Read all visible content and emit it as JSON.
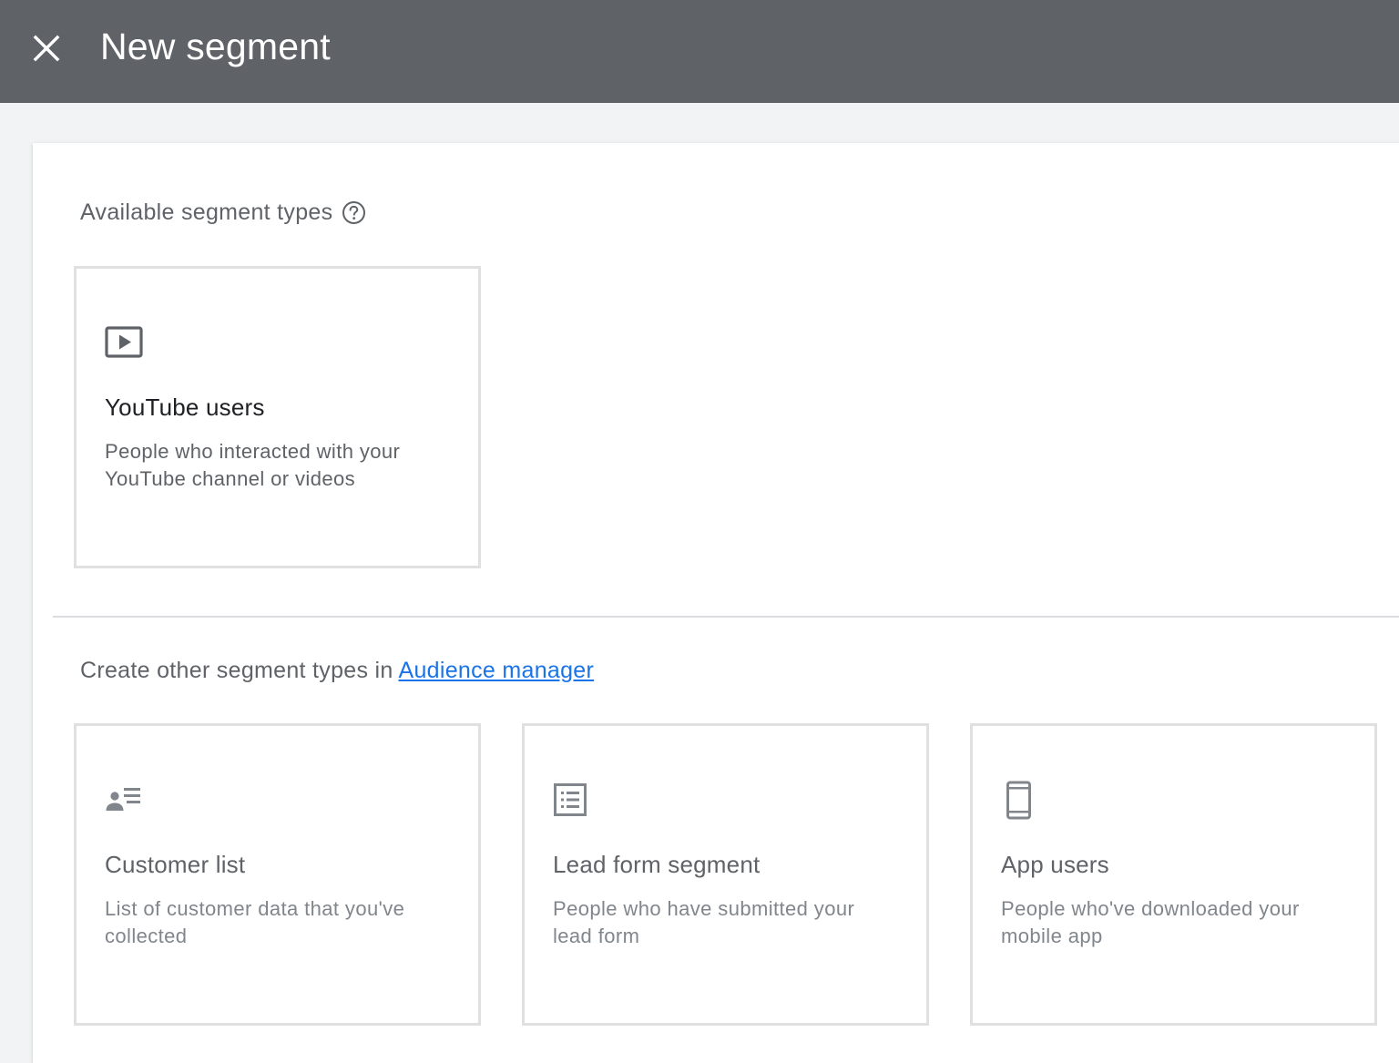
{
  "header": {
    "title": "New segment",
    "close_icon": "close-icon",
    "background": "#5f6368"
  },
  "available": {
    "heading": "Available segment types",
    "help_icon": "help-circle-icon",
    "cards": [
      {
        "icon": "video-play-icon",
        "title": "YouTube users",
        "description": "People who interacted with your YouTube channel or videos"
      }
    ]
  },
  "other": {
    "heading_prefix": "Create other segment types in ",
    "link_label": "Audience manager",
    "link_color": "#1a73e8",
    "cards": [
      {
        "icon": "customer-list-icon",
        "title": "Customer list",
        "description": "List of customer data that you've collected"
      },
      {
        "icon": "form-list-icon",
        "title": "Lead form segment",
        "description": "People who have submitted your lead form"
      },
      {
        "icon": "mobile-phone-icon",
        "title": "App users",
        "description": "People who've downloaded your mobile app"
      }
    ]
  }
}
